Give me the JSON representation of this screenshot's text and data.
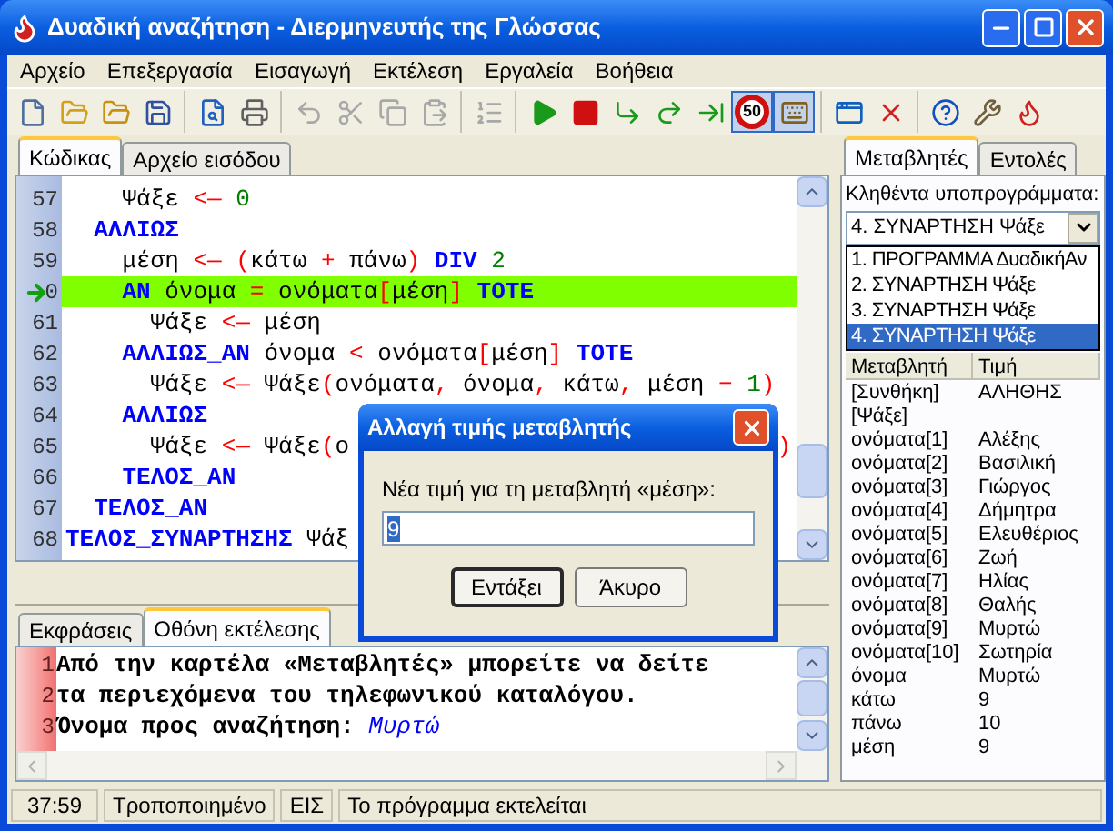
{
  "window": {
    "title": "Δυαδική αναζήτηση - Διερμηνευτής της Γλώσσας"
  },
  "menu": [
    "Αρχείο",
    "Επεξεργασία",
    "Εισαγωγή",
    "Εκτέλεση",
    "Εργαλεία",
    "Βοήθεια"
  ],
  "toolbar": [
    [
      {
        "kind": "new",
        "disabled": false,
        "pressed": false
      },
      {
        "kind": "open",
        "disabled": false,
        "pressed": false
      },
      {
        "kind": "open-recent",
        "disabled": false,
        "pressed": false
      },
      {
        "kind": "save",
        "disabled": false,
        "pressed": false
      }
    ],
    [
      {
        "kind": "preview",
        "disabled": false,
        "pressed": false
      },
      {
        "kind": "print",
        "disabled": false,
        "pressed": false
      }
    ],
    [
      {
        "kind": "undo",
        "disabled": true,
        "pressed": false
      },
      {
        "kind": "cut",
        "disabled": true,
        "pressed": false
      },
      {
        "kind": "copy",
        "disabled": true,
        "pressed": false
      },
      {
        "kind": "paste",
        "disabled": true,
        "pressed": false
      }
    ],
    [
      {
        "kind": "renumber",
        "disabled": true,
        "pressed": false
      }
    ],
    [
      {
        "kind": "run",
        "disabled": false,
        "pressed": false
      },
      {
        "kind": "stop",
        "disabled": false,
        "pressed": false
      },
      {
        "kind": "step-into",
        "disabled": false,
        "pressed": false
      },
      {
        "kind": "step-over",
        "disabled": false,
        "pressed": false
      },
      {
        "kind": "step-out",
        "disabled": false,
        "pressed": false
      },
      {
        "kind": "speed",
        "label": "50",
        "disabled": false,
        "pressed": true
      },
      {
        "kind": "trace",
        "disabled": false,
        "pressed": true
      }
    ],
    [
      {
        "kind": "window",
        "disabled": false,
        "pressed": false
      },
      {
        "kind": "clear",
        "disabled": false,
        "pressed": false
      }
    ],
    [
      {
        "kind": "help",
        "disabled": false,
        "pressed": false
      },
      {
        "kind": "tools",
        "disabled": false,
        "pressed": false
      },
      {
        "kind": "logo",
        "disabled": false,
        "pressed": false
      }
    ]
  ],
  "editor": {
    "tabs": [
      {
        "label": "Κώδικας",
        "selected": true
      },
      {
        "label": "Αρχείο εισόδου",
        "selected": false
      }
    ],
    "lines": [
      {
        "num": "57",
        "current": false,
        "tokens": [
          {
            "kind": "id",
            "text": "    Ψάξε "
          },
          {
            "kind": "op",
            "text": "<—"
          },
          {
            "kind": "num",
            "text": " 0"
          }
        ]
      },
      {
        "num": "58",
        "current": false,
        "tokens": [
          {
            "kind": "kw",
            "text": "  ΑΛΛΙΩΣ"
          }
        ]
      },
      {
        "num": "59",
        "current": false,
        "tokens": [
          {
            "kind": "id",
            "text": "    μέση "
          },
          {
            "kind": "op",
            "text": "<— ("
          },
          {
            "kind": "id",
            "text": "κάτω "
          },
          {
            "kind": "op",
            "text": "+"
          },
          {
            "kind": "id",
            "text": " πάνω"
          },
          {
            "kind": "op",
            "text": ")"
          },
          {
            "kind": "kw",
            "text": " DIV"
          },
          {
            "kind": "num",
            "text": " 2"
          }
        ]
      },
      {
        "num": "0",
        "current": true,
        "tokens": [
          {
            "kind": "kw",
            "text": "    ΑΝ"
          },
          {
            "kind": "id",
            "text": " όνομα "
          },
          {
            "kind": "op",
            "text": "="
          },
          {
            "kind": "id",
            "text": " ονόματα"
          },
          {
            "kind": "op",
            "text": "["
          },
          {
            "kind": "id",
            "text": "μέση"
          },
          {
            "kind": "op",
            "text": "]"
          },
          {
            "kind": "kw",
            "text": " ΤΟΤΕ"
          }
        ]
      },
      {
        "num": "61",
        "current": false,
        "tokens": [
          {
            "kind": "id",
            "text": "      Ψάξε "
          },
          {
            "kind": "op",
            "text": "<—"
          },
          {
            "kind": "id",
            "text": " μέση"
          }
        ]
      },
      {
        "num": "62",
        "current": false,
        "tokens": [
          {
            "kind": "kw",
            "text": "    ΑΛΛΙΩΣ_ΑΝ"
          },
          {
            "kind": "id",
            "text": " όνομα "
          },
          {
            "kind": "op",
            "text": "<"
          },
          {
            "kind": "id",
            "text": " ονόματα"
          },
          {
            "kind": "op",
            "text": "["
          },
          {
            "kind": "id",
            "text": "μέση"
          },
          {
            "kind": "op",
            "text": "]"
          },
          {
            "kind": "kw",
            "text": " ΤΟΤΕ"
          }
        ]
      },
      {
        "num": "63",
        "current": false,
        "tokens": [
          {
            "kind": "id",
            "text": "      Ψάξε "
          },
          {
            "kind": "op",
            "text": "<—"
          },
          {
            "kind": "id",
            "text": " Ψάξε"
          },
          {
            "kind": "op",
            "text": "("
          },
          {
            "kind": "id",
            "text": "ονόματα"
          },
          {
            "kind": "op",
            "text": ","
          },
          {
            "kind": "id",
            "text": " όνομα"
          },
          {
            "kind": "op",
            "text": ","
          },
          {
            "kind": "id",
            "text": " κάτω"
          },
          {
            "kind": "op",
            "text": ","
          },
          {
            "kind": "id",
            "text": " μέση "
          },
          {
            "kind": "op",
            "text": "−"
          },
          {
            "kind": "num",
            "text": " 1"
          },
          {
            "kind": "op",
            "text": ")"
          }
        ]
      },
      {
        "num": "64",
        "current": false,
        "tokens": [
          {
            "kind": "kw",
            "text": "    ΑΛΛΙΩΣ"
          }
        ]
      },
      {
        "num": "65",
        "current": false,
        "tokens": [
          {
            "kind": "id",
            "text": "      Ψάξε "
          },
          {
            "kind": "op",
            "text": "<—"
          },
          {
            "kind": "id",
            "text": " Ψάξε"
          },
          {
            "kind": "op",
            "text": "("
          },
          {
            "kind": "id",
            "text": "ο"
          }
        ],
        "tail": {
          "kind": "op",
          "text": ")"
        }
      },
      {
        "num": "66",
        "current": false,
        "tokens": [
          {
            "kind": "kw",
            "text": "    ΤΕΛΟΣ_ΑΝ"
          }
        ]
      },
      {
        "num": "67",
        "current": false,
        "tokens": [
          {
            "kind": "kw",
            "text": "  ΤΕΛΟΣ_ΑΝ"
          }
        ]
      },
      {
        "num": "68",
        "current": false,
        "tokens": [
          {
            "kind": "kw",
            "text": "ΤΕΛΟΣ_ΣΥΝΑΡΤΗΣΗΣ"
          },
          {
            "kind": "id",
            "text": " Ψάξ"
          }
        ]
      }
    ]
  },
  "output": {
    "tabs": [
      {
        "label": "Εκφράσεις",
        "selected": false
      },
      {
        "label": "Οθόνη εκτέλεσης",
        "selected": true
      }
    ],
    "lines": [
      {
        "num": "1",
        "segments": [
          {
            "kind": "out",
            "text": "Από την καρτέλα «Μεταβλητές» μπορείτε να δείτε"
          }
        ]
      },
      {
        "num": "2",
        "segments": [
          {
            "kind": "out",
            "text": "τα περιεχόμενα του τηλεφωνικού καταλόγου."
          }
        ]
      },
      {
        "num": "3",
        "segments": [
          {
            "kind": "out",
            "text": "Όνομα προς αναζήτηση: "
          },
          {
            "kind": "in",
            "text": "Μυρτώ"
          }
        ]
      }
    ]
  },
  "status_bar": [
    "37:59",
    "Τροποποιημένο",
    "ΕΙΣ",
    "Το πρόγραμμα εκτελείται"
  ],
  "side": {
    "tabs": [
      {
        "label": "Μεταβλητές",
        "selected": true
      },
      {
        "label": "Εντολές",
        "selected": false
      }
    ],
    "label": "Κληθέντα υποπρογράμματα:",
    "combo": {
      "value": "4. ΣΥΝΑΡΤΗΣΗ Ψάξε"
    },
    "list": [
      {
        "label": "1. ΠΡΟΓΡΑΜΜΑ ΔυαδικήΑν",
        "selected": false
      },
      {
        "label": "2. ΣΥΝΑΡΤΗΣΗ Ψάξε",
        "selected": false
      },
      {
        "label": "3. ΣΥΝΑΡΤΗΣΗ Ψάξε",
        "selected": false
      },
      {
        "label": "4. ΣΥΝΑΡΤΗΣΗ Ψάξε",
        "selected": true
      }
    ],
    "table": {
      "columns": [
        "Μεταβλητή",
        "Τιμή"
      ],
      "rows": [
        [
          "[Συνθήκη]",
          "ΑΛΗΘΗΣ"
        ],
        [
          "[Ψάξε]"
        ],
        [
          "ονόματα[1]",
          "Αλέξης"
        ],
        [
          "ονόματα[2]",
          "Βασιλική"
        ],
        [
          "ονόματα[3]",
          "Γιώργος"
        ],
        [
          "ονόματα[4]",
          "Δήμητρα"
        ],
        [
          "ονόματα[5]",
          "Ελευθέριος"
        ],
        [
          "ονόματα[6]",
          "Ζωή"
        ],
        [
          "ονόματα[7]",
          "Ηλίας"
        ],
        [
          "ονόματα[8]",
          "Θαλής"
        ],
        [
          "ονόματα[9]",
          "Μυρτώ"
        ],
        [
          "ονόματα[10]",
          "Σωτηρία"
        ],
        [
          "όνομα",
          "Μυρτώ"
        ],
        [
          "κάτω",
          "9"
        ],
        [
          "πάνω",
          "10"
        ],
        [
          "μέση",
          "9"
        ]
      ]
    }
  },
  "dialog": {
    "title": "Αλλαγή τιμής μεταβλητής",
    "prompt": "Νέα τιμή για τη μεταβλητή «μέση»:",
    "value": "9",
    "buttons": [
      {
        "label": "Εντάξει",
        "default": true
      },
      {
        "label": "Άκυρο",
        "default": false
      }
    ]
  }
}
